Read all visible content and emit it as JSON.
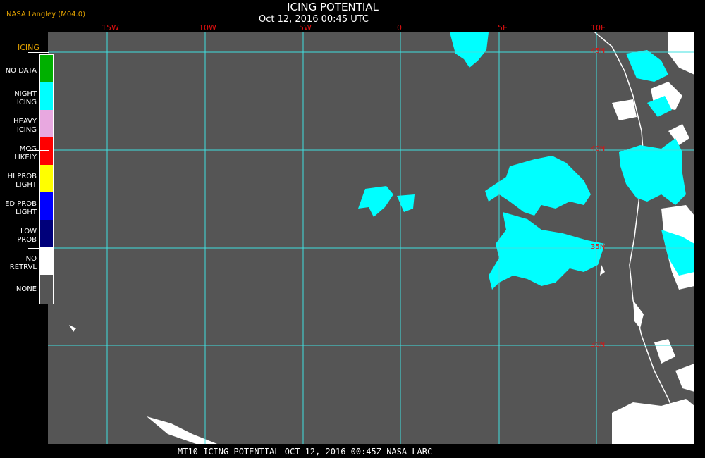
{
  "header": {
    "credit": "NASA Langley (M04.0)",
    "title": "ICING POTENTIAL",
    "subtitle": "Oct 12, 2016 00:45 UTC"
  },
  "legend": {
    "title": "ICING",
    "items": [
      {
        "line1": "NO DATA",
        "line2": "",
        "color": "#00b000"
      },
      {
        "line1": "NIGHT",
        "line2": "ICING",
        "color": "#00ffff"
      },
      {
        "line1": "HEAVY",
        "line2": "ICING",
        "color": "#e8a8e0"
      },
      {
        "line1": "MOG",
        "line2": "LIKELY",
        "color": "#ff0000"
      },
      {
        "line1": "HI PROB",
        "line2": "LIGHT",
        "color": "#ffff00"
      },
      {
        "line1": "ED PROB",
        "line2": "LIGHT",
        "color": "#0000ff"
      },
      {
        "line1": "LOW",
        "line2": "PROB",
        "color": "#00007a"
      },
      {
        "line1": "NO",
        "line2": "RETRVL",
        "color": "#ffffff"
      },
      {
        "line1": "NONE",
        "line2": "",
        "color": "#555555"
      }
    ]
  },
  "grid": {
    "lon_labels": [
      "15W",
      "10W",
      "5W",
      "0",
      "5E",
      "10E"
    ],
    "lat_labels": [
      "45N",
      "40N",
      "35N",
      "30N"
    ]
  },
  "footer": {
    "text": "MT10  ICING POTENTIAL   OCT 12, 2016 00:45Z   NASA LARC"
  },
  "colors": {
    "grid_line": "#40e0e0",
    "coast": "#ffffff",
    "night_icing": "#00ffff",
    "no_retrieval": "#ffffff",
    "background": "#555555"
  }
}
